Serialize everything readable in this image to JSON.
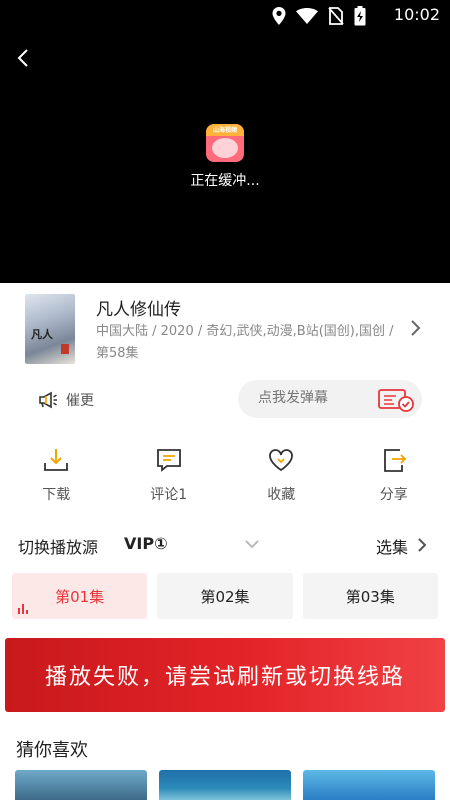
{
  "status_bar": {
    "time": "10:02",
    "icons": [
      "location-icon",
      "wifi-icon",
      "no-sim-icon",
      "battery-charging-icon"
    ]
  },
  "player": {
    "app_logo_text": "山海视频",
    "buffering_text": "正在缓冲..."
  },
  "show": {
    "title": "凡人修仙传",
    "meta": "中国大陆 / 2020 / 奇幻,武侠,动漫,B站(国创),国创 / 第58集",
    "poster_text": "凡人"
  },
  "interaction": {
    "urge_label": "催更",
    "danmaku_placeholder": "点我发弹幕"
  },
  "actions": [
    {
      "label": "下载",
      "icon": "download-icon"
    },
    {
      "label": "评论1",
      "icon": "comment-icon"
    },
    {
      "label": "收藏",
      "icon": "heart-icon"
    },
    {
      "label": "分享",
      "icon": "share-icon"
    }
  ],
  "source": {
    "label": "切换播放源",
    "value": "VIP①",
    "pick_label": "选集"
  },
  "episodes": [
    {
      "label": "第01集",
      "active": true
    },
    {
      "label": "第02集",
      "active": false
    },
    {
      "label": "第03集",
      "active": false
    }
  ],
  "error_banner": "播放失败，请尝试刷新或切换线路",
  "recommend": {
    "title": "猜你喜欢"
  },
  "colors": {
    "accent": "#e8353a",
    "banner": "#e32428",
    "player_bg": "#000000"
  }
}
